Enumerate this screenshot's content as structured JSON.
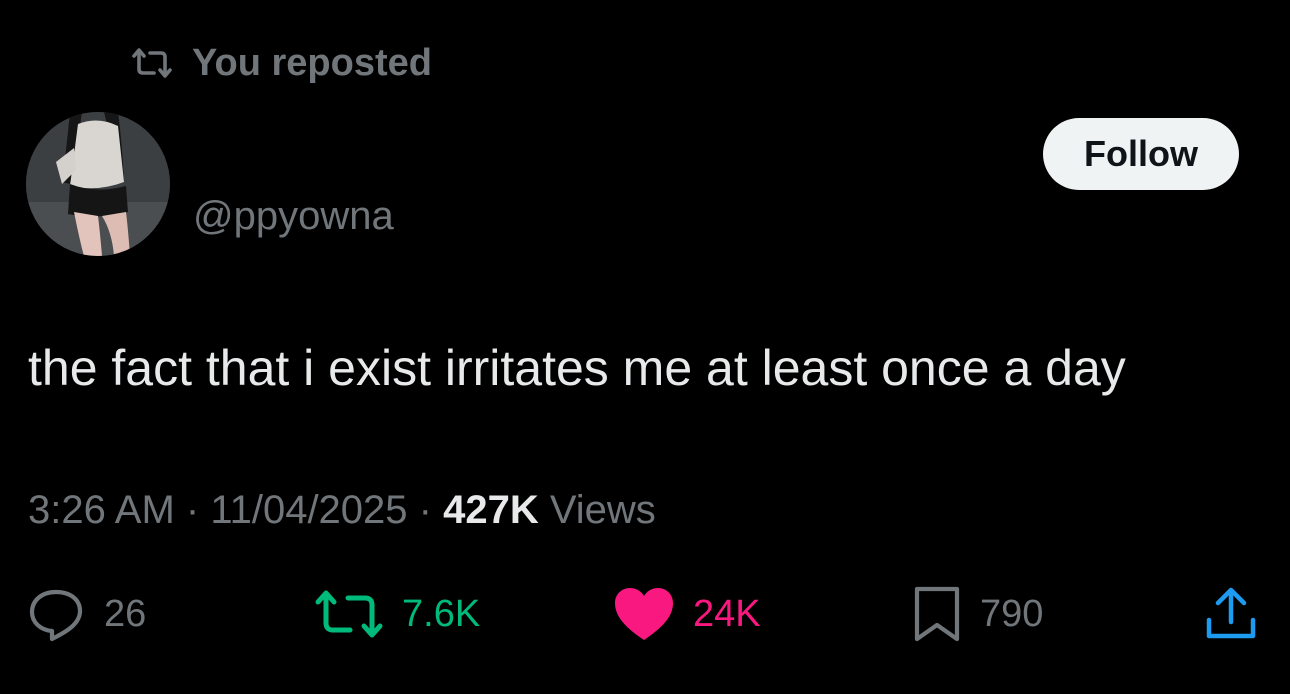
{
  "repost_banner": {
    "text": "You reposted",
    "icon": "repost-icon"
  },
  "author": {
    "handle": "@ppyowna",
    "avatar_icon": "avatar-photo"
  },
  "follow_button": {
    "label": "Follow"
  },
  "tweet": {
    "text": "the fact that i exist irritates me at least once a day",
    "time": "3:26 AM",
    "separator": " · ",
    "date": "11/04/2025",
    "views_count": "427K",
    "views_label": " Views"
  },
  "actions": {
    "reply": {
      "icon": "reply-icon",
      "count": "26"
    },
    "repost": {
      "icon": "repost-icon",
      "count": "7.6K",
      "color": "#00ba7c"
    },
    "like": {
      "icon": "heart-icon",
      "count": "24K",
      "color": "#f91880"
    },
    "bookmark": {
      "icon": "bookmark-icon",
      "count": "790"
    },
    "share": {
      "icon": "share-icon",
      "color": "#1d9bf0"
    }
  },
  "colors": {
    "background": "#000000",
    "text_primary": "#e7e9ea",
    "text_secondary": "#71767b",
    "repost_active": "#00ba7c",
    "like_active": "#f91880",
    "share": "#1d9bf0"
  }
}
